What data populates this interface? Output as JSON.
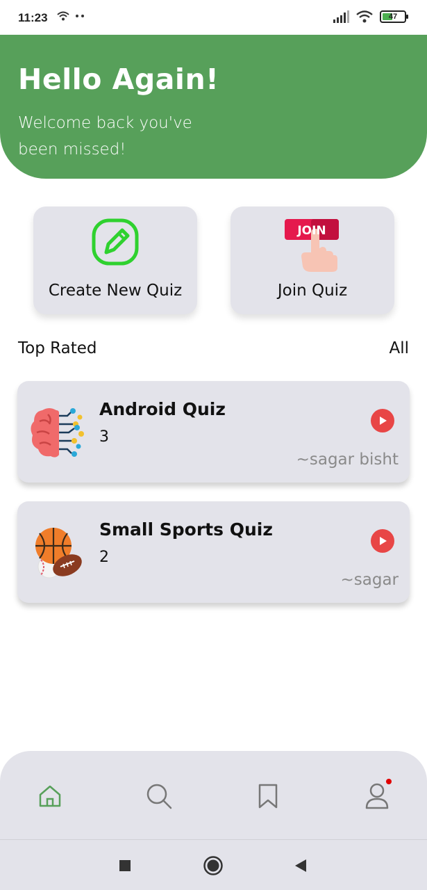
{
  "status_bar": {
    "time": "11:23",
    "battery": "47",
    "icons": [
      "wifi-icon",
      "dots-icon",
      "signal-icon",
      "wifi-icon",
      "battery-icon"
    ]
  },
  "header": {
    "title": "Hello Again!",
    "subtitle": "Welcome back you've been missed!"
  },
  "actions": {
    "create_label": "Create New Quiz",
    "join_label": "Join Quiz",
    "join_badge": "JOIN"
  },
  "section": {
    "title": "Top Rated",
    "all_label": "All"
  },
  "quizzes": [
    {
      "title": "Android Quiz",
      "count": "3",
      "author": "~sagar bisht",
      "icon": "brain-icon"
    },
    {
      "title": "Small Sports Quiz",
      "count": "2",
      "author": "~sagar",
      "icon": "sports-balls-icon"
    }
  ],
  "bottom_nav": {
    "items": [
      "home-icon",
      "search-icon",
      "bookmark-icon",
      "profile-icon"
    ],
    "active": "home-icon"
  },
  "colors": {
    "primary_green": "#57a05a",
    "card_bg": "#e3e3ea",
    "play_red": "#e84646",
    "notification_dot": "#e10000"
  }
}
